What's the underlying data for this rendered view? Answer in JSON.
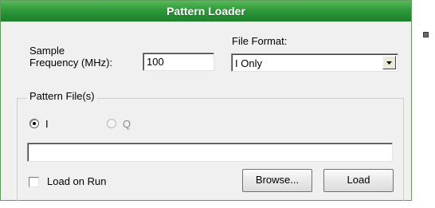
{
  "title": "Pattern Loader",
  "sample_frequency": {
    "label_line1": "Sample",
    "label_line2": "Frequency (MHz):",
    "value": "100"
  },
  "file_format": {
    "label": "File Format:",
    "selected": "I Only"
  },
  "pattern_files": {
    "legend": "Pattern File(s)",
    "radio_i_label": "I",
    "radio_q_label": "Q",
    "radio_selected": "I",
    "path_value": ""
  },
  "load_on_run": {
    "label": "Load on Run",
    "checked": false
  },
  "buttons": {
    "browse": "Browse...",
    "load": "Load"
  },
  "colors": {
    "title_bar": "#2f9a3a",
    "panel_bg": "#f0f0f0"
  },
  "icons": {
    "dropdown": "chevron-down-icon",
    "scroll": "scroll-nub-icon"
  }
}
